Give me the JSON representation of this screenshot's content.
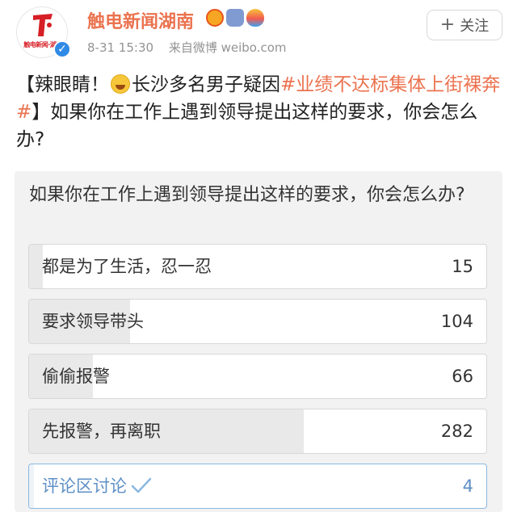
{
  "header": {
    "username": "触电新闻湖南",
    "avatar_caption": "触电新闻·湖南",
    "timestamp": "8-31 15:30",
    "source": "来自微博 weibo.com",
    "follow_label": "关注",
    "badges": [
      "crown-badge-icon",
      "backpack-badge-icon",
      "balloon-badge-icon"
    ],
    "brand_color": "#d61f26",
    "name_color": "#eb7350"
  },
  "post": {
    "part1": "【辣眼睛！",
    "emoji": "laugh-cry-emoji-icon",
    "part2": "长沙多名男子疑因",
    "topic": "#业绩不达标集体上街裸奔#",
    "part3": "】如果你在工作上遇到领导提出这样的要求，你会怎么办?"
  },
  "poll": {
    "question": "如果你在工作上遇到领导提出这样的要求，你会怎么办?",
    "options": [
      {
        "label": "都是为了生活，忍一忍",
        "count": "15",
        "fraction": 0.03
      },
      {
        "label": "要求领导带头",
        "count": "104",
        "fraction": 0.22
      },
      {
        "label": "偷偷报警",
        "count": "66",
        "fraction": 0.14
      },
      {
        "label": "先报警，再离职",
        "count": "282",
        "fraction": 0.6
      },
      {
        "label": "评论区讨论",
        "count": "4",
        "fraction": 0.01,
        "selected": true
      }
    ],
    "accent_color": "#5d8fc5"
  }
}
